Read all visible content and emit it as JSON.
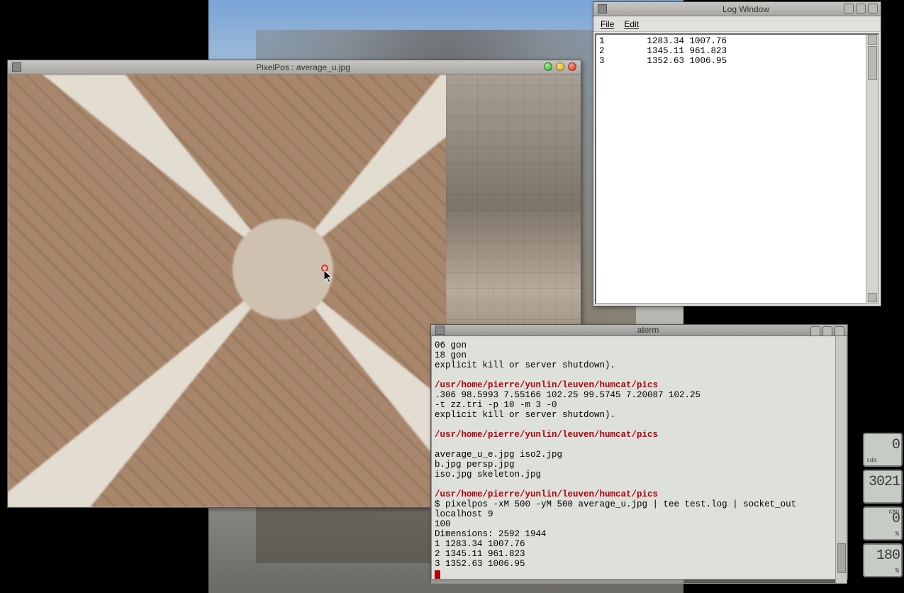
{
  "pixelpos": {
    "title": "PixelPos : average_u.jpg"
  },
  "logwin": {
    "title": "Log Window",
    "menu": {
      "file": "File",
      "edit": "Edit"
    },
    "rows": [
      {
        "n": "1",
        "x": "1283.34",
        "y": "1007.76"
      },
      {
        "n": "2",
        "x": "1345.11",
        "y": "961.823"
      },
      {
        "n": "3",
        "x": "1352.63",
        "y": "1006.95"
      }
    ]
  },
  "aterm": {
    "title": "aterm",
    "lines": [
      {
        "cls": "black",
        "t": "06 gon"
      },
      {
        "cls": "black",
        "t": "18 gon"
      },
      {
        "cls": "black",
        "t": "explicit kill or server shutdown)."
      },
      {
        "cls": "blank",
        "t": ""
      },
      {
        "cls": "red",
        "t": "/usr/home/pierre/yunlin/leuven/humcat/pics"
      },
      {
        "cls": "black",
        "t": ".306 98.5993 7.55166 102.25 99.5745 7.20087 102.25"
      },
      {
        "cls": "black",
        "t": " -t zz.tri -p 10 -m 3 -0"
      },
      {
        "cls": "black",
        "t": "explicit kill or server shutdown)."
      },
      {
        "cls": "blank",
        "t": ""
      },
      {
        "cls": "red",
        "t": "/usr/home/pierre/yunlin/leuven/humcat/pics"
      },
      {
        "cls": "blank",
        "t": ""
      },
      {
        "cls": "black",
        "t": "   average_u_e.jpg  iso2.jpg"
      },
      {
        "cls": "black",
        "t": "   b.jpg            persp.jpg"
      },
      {
        "cls": "black",
        "t": "   iso.jpg          skeleton.jpg"
      },
      {
        "cls": "blank",
        "t": ""
      },
      {
        "cls": "red",
        "t": "/usr/home/pierre/yunlin/leuven/humcat/pics"
      },
      {
        "cls": "black",
        "t": "$ pixelpos -xM 500 -yM 500 average_u.jpg | tee test.log | socket_out localhost 9"
      },
      {
        "cls": "black",
        "t": "100"
      },
      {
        "cls": "black",
        "t": "Dimensions: 2592 1944"
      },
      {
        "cls": "black",
        "t": "1 1283.34 1007.76"
      },
      {
        "cls": "black",
        "t": "2 1345.11 961.823"
      },
      {
        "cls": "black",
        "t": "3 1352.63 1006.95"
      }
    ]
  },
  "monitors": [
    {
      "big": "0",
      "lab": "sda",
      "sub": ""
    },
    {
      "big": "3021",
      "lab": "",
      "sub": ""
    },
    {
      "big": "0",
      "lab": "",
      "sub": "%",
      "corner": "CPU"
    },
    {
      "big": "180",
      "lab": "",
      "sub": "%"
    }
  ]
}
